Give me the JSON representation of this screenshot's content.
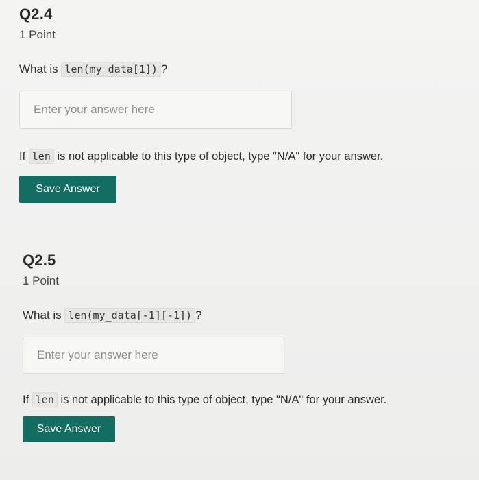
{
  "questions": [
    {
      "title": "Q2.4",
      "points": "1 Point",
      "prompt_prefix": "What is",
      "prompt_code": "len(my_data[1])",
      "prompt_suffix": "?",
      "answer_placeholder": "Enter your answer here",
      "note_prefix": "If",
      "note_code": "len",
      "note_suffix": "is not applicable to this type of object, type \"N/A\" for your answer.",
      "save_label": "Save Answer"
    },
    {
      "title": "Q2.5",
      "points": "1 Point",
      "prompt_prefix": "What is",
      "prompt_code": "len(my_data[-1][-1])",
      "prompt_suffix": "?",
      "answer_placeholder": "Enter your answer here",
      "note_prefix": "If",
      "note_code": "len",
      "note_suffix": "is not applicable to this type of object, type \"N/A\" for your answer.",
      "save_label": "Save Answer"
    }
  ],
  "colors": {
    "button": "#136d62",
    "background": "#f0f0ef",
    "code_background": "#e6e6e5"
  }
}
